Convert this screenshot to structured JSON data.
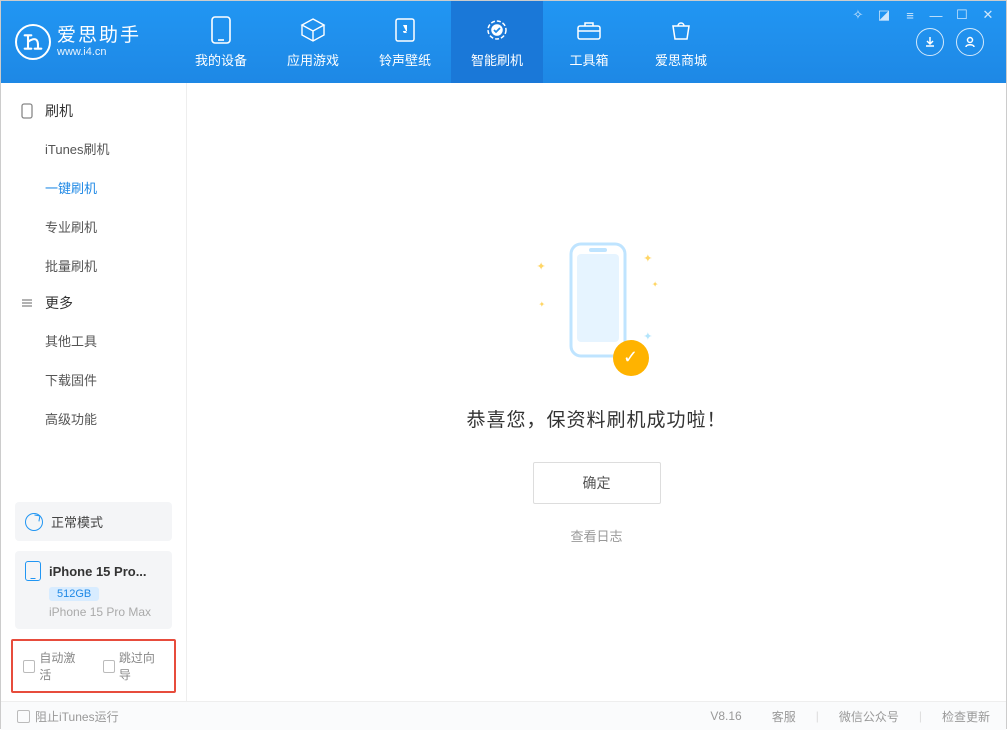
{
  "app": {
    "title": "爱思助手",
    "subtitle": "www.i4.cn"
  },
  "nav": {
    "items": [
      {
        "label": "我的设备",
        "icon": "device-icon"
      },
      {
        "label": "应用游戏",
        "icon": "cube-icon"
      },
      {
        "label": "铃声壁纸",
        "icon": "music-icon"
      },
      {
        "label": "智能刷机",
        "icon": "flash-icon",
        "active": true
      },
      {
        "label": "工具箱",
        "icon": "toolbox-icon"
      },
      {
        "label": "爱思商城",
        "icon": "shop-icon"
      }
    ]
  },
  "sidebar": {
    "groups": [
      {
        "header": "刷机",
        "icon": "device-small-icon",
        "items": [
          {
            "label": "iTunes刷机"
          },
          {
            "label": "一键刷机",
            "active": true
          },
          {
            "label": "专业刷机"
          },
          {
            "label": "批量刷机"
          }
        ]
      },
      {
        "header": "更多",
        "icon": "more-icon",
        "items": [
          {
            "label": "其他工具"
          },
          {
            "label": "下载固件"
          },
          {
            "label": "高级功能"
          }
        ]
      }
    ],
    "mode": {
      "label": "正常模式"
    },
    "device": {
      "name": "iPhone 15 Pro...",
      "storage": "512GB",
      "sub": "iPhone 15 Pro Max"
    },
    "checks": {
      "auto_activate": "自动激活",
      "skip_guide": "跳过向导"
    }
  },
  "main": {
    "success_text": "恭喜您，保资料刷机成功啦！",
    "ok_button": "确定",
    "log_link": "查看日志"
  },
  "footer": {
    "block_itunes": "阻止iTunes运行",
    "version": "V8.16",
    "links": {
      "support": "客服",
      "wechat": "微信公众号",
      "update": "检查更新"
    }
  }
}
